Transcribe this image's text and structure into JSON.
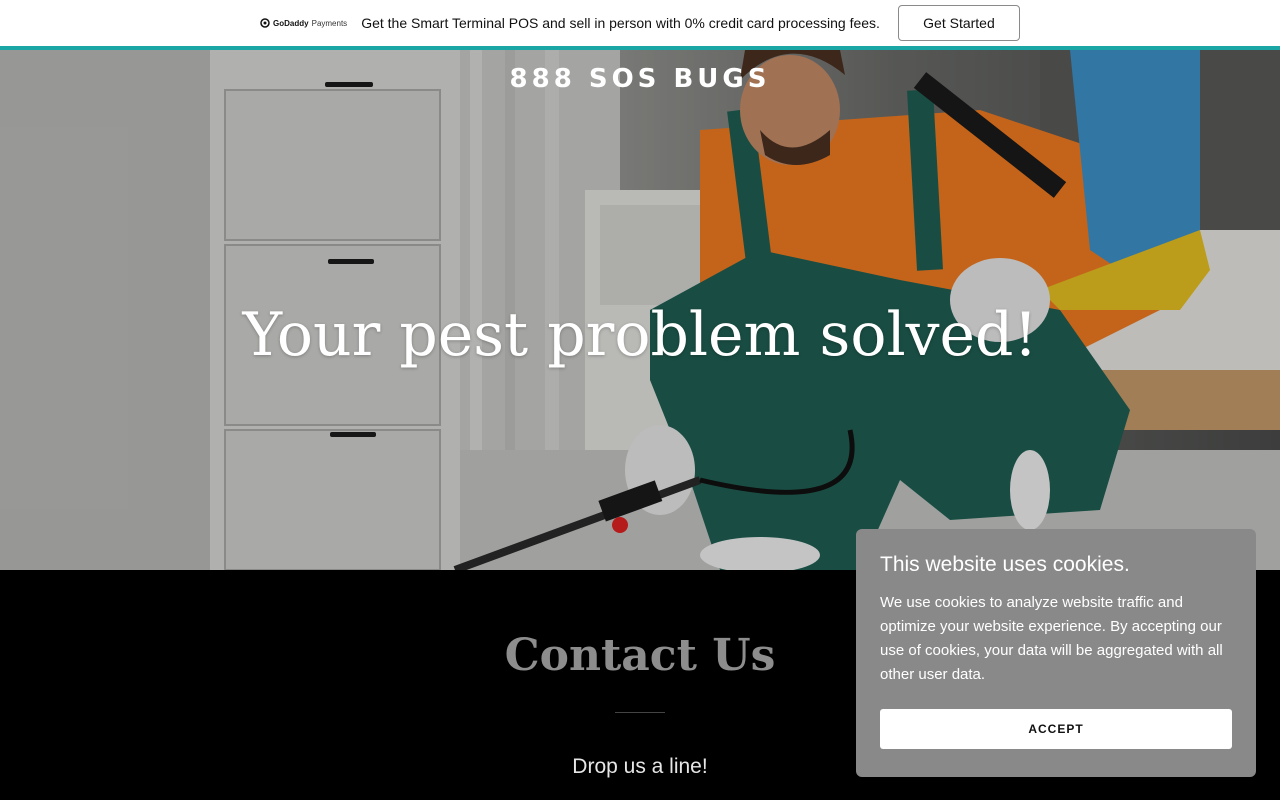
{
  "promo": {
    "brand": "GoDaddy",
    "brand_suffix": "Payments",
    "text": "Get the Smart Terminal POS and sell in person with 0% credit card processing fees.",
    "cta_label": "Get Started",
    "accent_color": "#1ba6a6"
  },
  "hero": {
    "brand_name": "888 SOS BUGS",
    "headline": "Your pest problem solved!"
  },
  "contact": {
    "title": "Contact Us",
    "subtitle": "Drop us a line!"
  },
  "cookie_banner": {
    "title": "This website uses cookies.",
    "body": "We use cookies to analyze website traffic and optimize your website experience. By accepting our use of cookies, your data will be aggregated with all other user data.",
    "accept_label": "ACCEPT"
  }
}
